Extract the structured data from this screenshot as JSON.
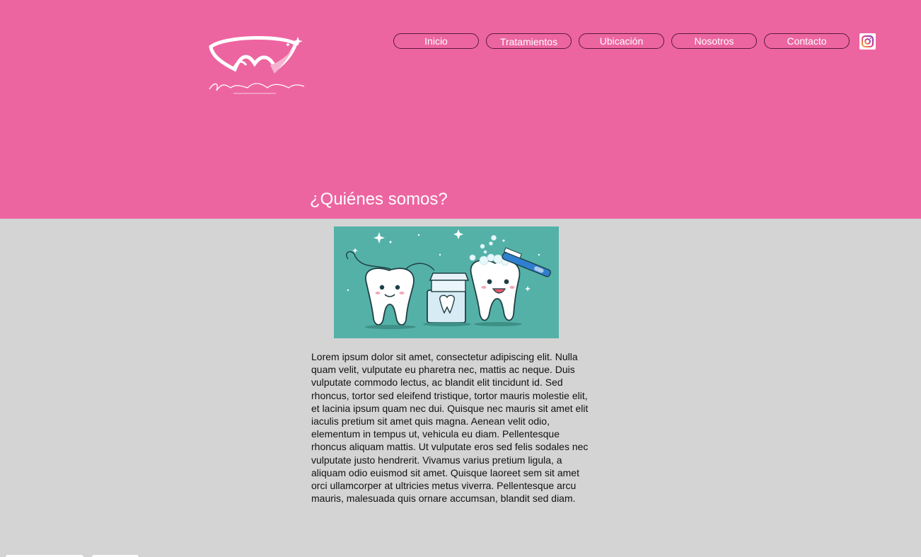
{
  "header": {
    "logo_alt": "Valeria Salazar",
    "nav": [
      {
        "label": "Inicio"
      },
      {
        "label": "Tratamientos"
      },
      {
        "label": "Ubicación"
      },
      {
        "label": "Nosotros"
      },
      {
        "label": "Contacto"
      }
    ],
    "social_icon": "instagram-icon"
  },
  "main": {
    "title": "¿Quiénes somos?",
    "image_icon": "teeth-illustration",
    "paragraph": "Lorem ipsum dolor sit amet, consectetur adipiscing elit. Nulla quam velit, vulputate eu pharetra nec, mattis ac neque. Duis vulputate commodo lectus, ac blandit elit tincidunt id. Sed rhoncus, tortor sed eleifend tristique, tortor mauris molestie elit, et lacinia ipsum quam nec dui. Quisque nec mauris sit amet elit iaculis pretium sit amet quis magna. Aenean velit odio, elementum in tempus ut, vehicula eu diam. Pellentesque rhoncus aliquam mattis. Ut vulputate eros sed felis sodales nec vulputate justo hendrerit. Vivamus varius pretium ligula, a aliquam odio euismod sit amet. Quisque laoreet sem sit amet orci ullamcorper at ultricies metus viverra. Pellentesque arcu mauris, malesuada quis ornare accumsan, blandit sed diam."
  },
  "colors": {
    "header_bg": "#ec65a0",
    "page_bg": "#d4d4d4",
    "image_bg": "#54b1a7"
  }
}
